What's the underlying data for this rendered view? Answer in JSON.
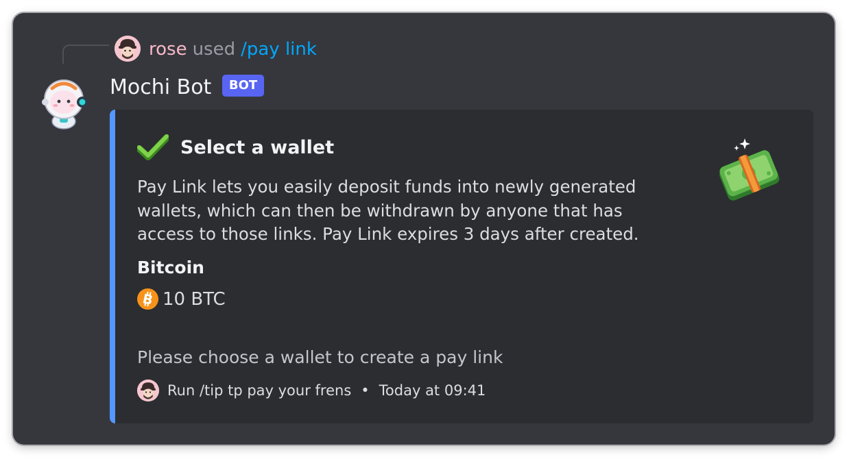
{
  "reply": {
    "username": "rose",
    "used_text": "used",
    "command": "/pay link"
  },
  "bot": {
    "name": "Mochi Bot",
    "badge": "BOT"
  },
  "embed": {
    "accent_color": "#5497ff",
    "title_icon": "check-mark-icon",
    "title": "Select a wallet",
    "thumbnail_icon": "money-with-wings-icon",
    "description": "Pay Link lets you easily deposit funds into newly generated wallets, which can then be withdrawn by anyone that has access to those links. Pay Link expires 3 days after created.",
    "field": {
      "name": "Bitcoin",
      "icon": "bitcoin-icon",
      "value": "10 BTC"
    },
    "note": "Please choose a wallet to create a pay link",
    "footer": {
      "text": "Run /tip tp pay your frens",
      "separator": "•",
      "timestamp": "Today at 09:41"
    }
  },
  "colors": {
    "background": "#36373d",
    "embed_background": "#2b2d31",
    "username": "#f7b9c6",
    "command": "#00a8fc",
    "badge": "#5865f2"
  }
}
